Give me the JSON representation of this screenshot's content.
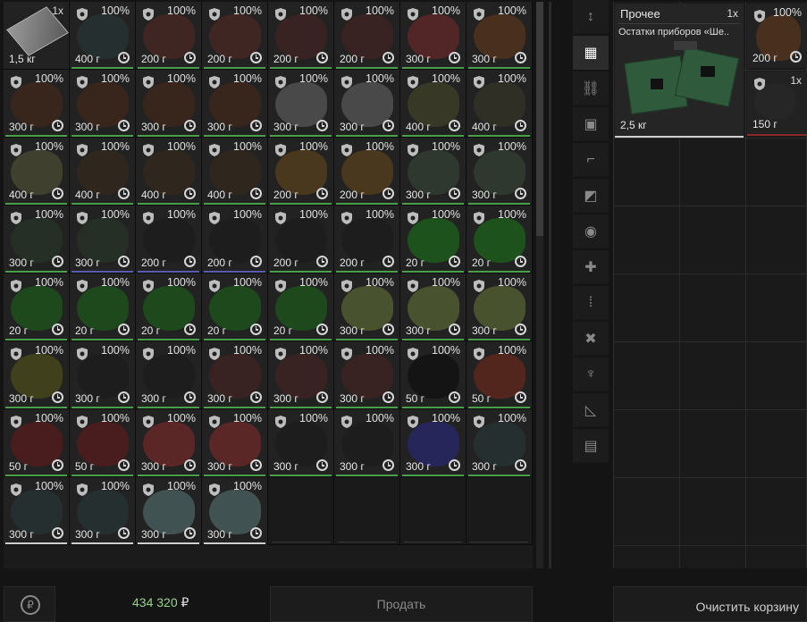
{
  "inventory": {
    "items": [
      {
        "pct": "",
        "qty": "1x",
        "weight": "1,5 кг",
        "color": "#8a8a8a",
        "bar": "none",
        "shield": false,
        "clock": false
      },
      {
        "pct": "100%",
        "weight": "400 г",
        "color": "#2a3a3a",
        "bar": "#4aa04a",
        "shield": true,
        "clock": true
      },
      {
        "pct": "100%",
        "weight": "200 г",
        "color": "#5a2a22",
        "bar": "#4aa04a",
        "shield": true,
        "clock": true
      },
      {
        "pct": "100%",
        "weight": "200 г",
        "color": "#5a2a22",
        "bar": "#4aa04a",
        "shield": true,
        "clock": true
      },
      {
        "pct": "100%",
        "weight": "200 г",
        "color": "#4a2422",
        "bar": "#4aa04a",
        "shield": true,
        "clock": true
      },
      {
        "pct": "100%",
        "weight": "200 г",
        "color": "#4a2422",
        "bar": "#4aa04a",
        "shield": true,
        "clock": true
      },
      {
        "pct": "100%",
        "weight": "300 г",
        "color": "#7a2a2a",
        "bar": "#4aa04a",
        "shield": true,
        "clock": true
      },
      {
        "pct": "100%",
        "weight": "300 г",
        "color": "#6a3a1a",
        "bar": "#4aa04a",
        "shield": true,
        "clock": true
      },
      {
        "pct": "100%",
        "weight": "300 г",
        "color": "#4a2a18",
        "bar": "#4aa04a",
        "shield": true,
        "clock": true
      },
      {
        "pct": "100%",
        "weight": "300 г",
        "color": "#4a2a18",
        "bar": "#4aa04a",
        "shield": true,
        "clock": true
      },
      {
        "pct": "100%",
        "weight": "300 г",
        "color": "#4a2a18",
        "bar": "#4aa04a",
        "shield": true,
        "clock": true
      },
      {
        "pct": "100%",
        "weight": "300 г",
        "color": "#4a2a18",
        "bar": "#4aa04a",
        "shield": true,
        "clock": true
      },
      {
        "pct": "100%",
        "weight": "300 г",
        "color": "#6a6a6a",
        "bar": "#4aa04a",
        "shield": true,
        "clock": true
      },
      {
        "pct": "100%",
        "weight": "300 г",
        "color": "#6a6a6a",
        "bar": "#4aa04a",
        "shield": true,
        "clock": true
      },
      {
        "pct": "100%",
        "weight": "400 г",
        "color": "#4a4a2a",
        "bar": "#4aa04a",
        "shield": true,
        "clock": true
      },
      {
        "pct": "100%",
        "weight": "400 г",
        "color": "#3a3a2a",
        "bar": "#4aa04a",
        "shield": true,
        "clock": true
      },
      {
        "pct": "100%",
        "weight": "400 г",
        "color": "#5a5a3a",
        "bar": "#4aa04a",
        "shield": true,
        "clock": true
      },
      {
        "pct": "100%",
        "weight": "400 г",
        "color": "#3a2a1a",
        "bar": "#4aa04a",
        "shield": true,
        "clock": true
      },
      {
        "pct": "100%",
        "weight": "400 г",
        "color": "#3a2a1a",
        "bar": "#4aa04a",
        "shield": true,
        "clock": true
      },
      {
        "pct": "100%",
        "weight": "400 г",
        "color": "#3a2a1a",
        "bar": "#4aa04a",
        "shield": true,
        "clock": true
      },
      {
        "pct": "100%",
        "weight": "200 г",
        "color": "#6a4a1a",
        "bar": "#4aa04a",
        "shield": true,
        "clock": true
      },
      {
        "pct": "100%",
        "weight": "200 г",
        "color": "#6a4a1a",
        "bar": "#4aa04a",
        "shield": true,
        "clock": true
      },
      {
        "pct": "100%",
        "weight": "300 г",
        "color": "#3a4a3a",
        "bar": "#4aa04a",
        "shield": true,
        "clock": true
      },
      {
        "pct": "100%",
        "weight": "300 г",
        "color": "#3a4a3a",
        "bar": "#4aa04a",
        "shield": true,
        "clock": true
      },
      {
        "pct": "100%",
        "weight": "300 г",
        "color": "#2a3a2a",
        "bar": "#4aa04a",
        "shield": true,
        "clock": true
      },
      {
        "pct": "100%",
        "weight": "300 г",
        "color": "#2a3a2a",
        "bar": "#5a5ab0",
        "shield": true,
        "clock": true
      },
      {
        "pct": "100%",
        "weight": "200 г",
        "color": "#1a1a1a",
        "bar": "#5a5ab0",
        "shield": true,
        "clock": true
      },
      {
        "pct": "100%",
        "weight": "200 г",
        "color": "#1a1a1a",
        "bar": "#5a5ab0",
        "shield": true,
        "clock": true
      },
      {
        "pct": "100%",
        "weight": "200 г",
        "color": "#1a1a1a",
        "bar": "#4aa04a",
        "shield": true,
        "clock": true
      },
      {
        "pct": "100%",
        "weight": "200 г",
        "color": "#1a1a1a",
        "bar": "#4aa04a",
        "shield": true,
        "clock": true
      },
      {
        "pct": "100%",
        "weight": "20 г",
        "color": "#1a7a1a",
        "bar": "#4aa04a",
        "shield": true,
        "clock": true
      },
      {
        "pct": "100%",
        "weight": "20 г",
        "color": "#1a7a1a",
        "bar": "#4aa04a",
        "shield": true,
        "clock": true
      },
      {
        "pct": "100%",
        "weight": "20 г",
        "color": "#1a6a1a",
        "bar": "#4aa04a",
        "shield": true,
        "clock": true
      },
      {
        "pct": "100%",
        "weight": "20 г",
        "color": "#1a6a1a",
        "bar": "#4aa04a",
        "shield": true,
        "clock": true
      },
      {
        "pct": "100%",
        "weight": "20 г",
        "color": "#1a6a1a",
        "bar": "#4aa04a",
        "shield": true,
        "clock": true
      },
      {
        "pct": "100%",
        "weight": "20 г",
        "color": "#1a6a1a",
        "bar": "#4aa04a",
        "shield": true,
        "clock": true
      },
      {
        "pct": "100%",
        "weight": "20 г",
        "color": "#1a6a1a",
        "bar": "#4aa04a",
        "shield": true,
        "clock": true
      },
      {
        "pct": "100%",
        "weight": "300 г",
        "color": "#6a7a3a",
        "bar": "#4aa04a",
        "shield": true,
        "clock": true
      },
      {
        "pct": "100%",
        "weight": "300 г",
        "color": "#6a7a3a",
        "bar": "#4aa04a",
        "shield": true,
        "clock": true
      },
      {
        "pct": "100%",
        "weight": "300 г",
        "color": "#6a7a3a",
        "bar": "#4aa04a",
        "shield": true,
        "clock": true
      },
      {
        "pct": "100%",
        "weight": "300 г",
        "color": "#5a5a1a",
        "bar": "#4aa04a",
        "shield": true,
        "clock": true
      },
      {
        "pct": "100%",
        "weight": "300 г",
        "color": "#1a1a1a",
        "bar": "#4aa04a",
        "shield": true,
        "clock": true
      },
      {
        "pct": "100%",
        "weight": "300 г",
        "color": "#1a1a1a",
        "bar": "#4aa04a",
        "shield": true,
        "clock": true
      },
      {
        "pct": "100%",
        "weight": "300 г",
        "color": "#4a2222",
        "bar": "#4aa04a",
        "shield": true,
        "clock": true
      },
      {
        "pct": "100%",
        "weight": "300 г",
        "color": "#4a2222",
        "bar": "#4aa04a",
        "shield": true,
        "clock": true
      },
      {
        "pct": "100%",
        "weight": "300 г",
        "color": "#4a2222",
        "bar": "#4aa04a",
        "shield": true,
        "clock": true
      },
      {
        "pct": "100%",
        "weight": "50 г",
        "color": "#0a0a0a",
        "bar": "#4aa04a",
        "shield": true,
        "clock": true
      },
      {
        "pct": "100%",
        "weight": "50 г",
        "color": "#7a2a1a",
        "bar": "#4aa04a",
        "shield": true,
        "clock": true
      },
      {
        "pct": "100%",
        "weight": "50 г",
        "color": "#6a1a1a",
        "bar": "#4aa04a",
        "shield": true,
        "clock": true
      },
      {
        "pct": "100%",
        "weight": "50 г",
        "color": "#6a1a1a",
        "bar": "#4aa04a",
        "shield": true,
        "clock": true
      },
      {
        "pct": "100%",
        "weight": "300 г",
        "color": "#8a2a2a",
        "bar": "#4aa04a",
        "shield": true,
        "clock": true
      },
      {
        "pct": "100%",
        "weight": "300 г",
        "color": "#8a2a2a",
        "bar": "#4aa04a",
        "shield": true,
        "clock": true
      },
      {
        "pct": "100%",
        "weight": "300 г",
        "color": "#1a1a1a",
        "bar": "#4aa04a",
        "shield": true,
        "clock": true
      },
      {
        "pct": "100%",
        "weight": "300 г",
        "color": "#1a1a1a",
        "bar": "#4aa04a",
        "shield": true,
        "clock": true
      },
      {
        "pct": "100%",
        "weight": "300 г",
        "color": "#2a2a8a",
        "bar": "#4aa04a",
        "shield": true,
        "clock": true
      },
      {
        "pct": "100%",
        "weight": "300 г",
        "color": "#2a3a3a",
        "bar": "#4aa04a",
        "shield": true,
        "clock": true
      },
      {
        "pct": "100%",
        "weight": "300 г",
        "color": "#2a3a3a",
        "bar": "#cfcfcf",
        "shield": true,
        "clock": true
      },
      {
        "pct": "100%",
        "weight": "300 г",
        "color": "#2a3a3a",
        "bar": "#cfcfcf",
        "shield": true,
        "clock": true
      },
      {
        "pct": "100%",
        "weight": "300 г",
        "color": "#5a7a7a",
        "bar": "#cfcfcf",
        "shield": true,
        "clock": true
      },
      {
        "pct": "100%",
        "weight": "300 г",
        "color": "#5a7a7a",
        "bar": "#cfcfcf",
        "shield": true,
        "clock": true
      }
    ],
    "empty_cells": 4
  },
  "categories": [
    {
      "icon": "sort-icon",
      "glyph": "↕"
    },
    {
      "icon": "grid-icon",
      "glyph": "▦",
      "active": true
    },
    {
      "icon": "link-icon",
      "glyph": "⛓"
    },
    {
      "icon": "backpack-icon",
      "glyph": "▣"
    },
    {
      "icon": "rifle-icon",
      "glyph": "⌐"
    },
    {
      "icon": "armor-icon",
      "glyph": "◩"
    },
    {
      "icon": "artifact-icon",
      "glyph": "◉"
    },
    {
      "icon": "medkit-icon",
      "glyph": "✚"
    },
    {
      "icon": "ammo-icon",
      "glyph": "⁞"
    },
    {
      "icon": "tools-icon",
      "glyph": "✖"
    },
    {
      "icon": "food-icon",
      "glyph": "♆"
    },
    {
      "icon": "ruler-icon",
      "glyph": "◺"
    },
    {
      "icon": "box-icon",
      "glyph": "▤"
    }
  ],
  "trade": {
    "big_item": {
      "title": "Прочее",
      "qty": "1x",
      "name": "Остатки приборов «Ше..",
      "weight": "2,5 кг"
    },
    "item_r1": {
      "pct": "100%",
      "weight": "200 г"
    },
    "item_r2": {
      "qty": "1x",
      "weight": "150 г"
    }
  },
  "bottom": {
    "money": "434 320",
    "currency": "₽",
    "sell_label": "Продать",
    "clear_label": "Очистить корзину",
    "refresh_glyph": "₽"
  }
}
